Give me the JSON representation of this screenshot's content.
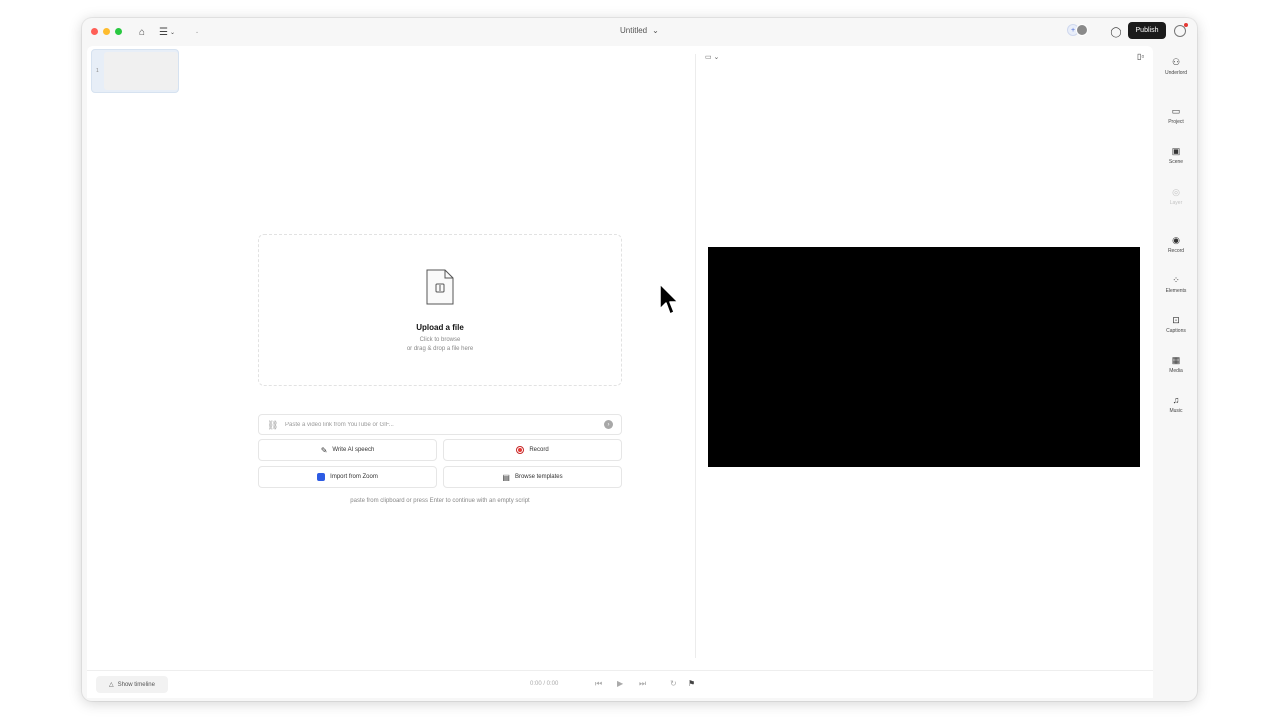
{
  "window": {
    "doc_title": "Untitled",
    "publish_label": "Publish"
  },
  "editor": {
    "scene_number": "1",
    "upload": {
      "title": "Upload a file",
      "subtitle_1": "Click to browse",
      "subtitle_2": "or drag & drop a file here"
    },
    "link_input": {
      "placeholder": "Paste a video link from YouTube or GIF..."
    },
    "actions": [
      {
        "label": "Write AI speech",
        "icon": "pen-sparkle-icon"
      },
      {
        "label": "Record",
        "icon": "record-icon"
      },
      {
        "label": "Import from Zoom",
        "icon": "zoom-icon"
      },
      {
        "label": "Browse templates",
        "icon": "template-icon"
      }
    ],
    "hint": "paste from clipboard or press Enter to continue with an empty script"
  },
  "sidebar": {
    "items": [
      {
        "label": "Underlord",
        "icon": "robot-icon",
        "enabled": true
      },
      {
        "label": "Project",
        "icon": "folder-icon",
        "enabled": true
      },
      {
        "label": "Scene",
        "icon": "scene-icon",
        "enabled": true
      },
      {
        "label": "Layer",
        "icon": "layer-icon",
        "enabled": false
      },
      {
        "label": "Record",
        "icon": "record-icon",
        "enabled": true
      },
      {
        "label": "Elements",
        "icon": "elements-icon",
        "enabled": true
      },
      {
        "label": "Captions",
        "icon": "captions-icon",
        "enabled": true
      },
      {
        "label": "Media",
        "icon": "media-icon",
        "enabled": true
      },
      {
        "label": "Music",
        "icon": "music-icon",
        "enabled": true
      }
    ]
  },
  "bottombar": {
    "timeline_label": "Show timeline",
    "timecode": "0:00 / 0:00"
  }
}
